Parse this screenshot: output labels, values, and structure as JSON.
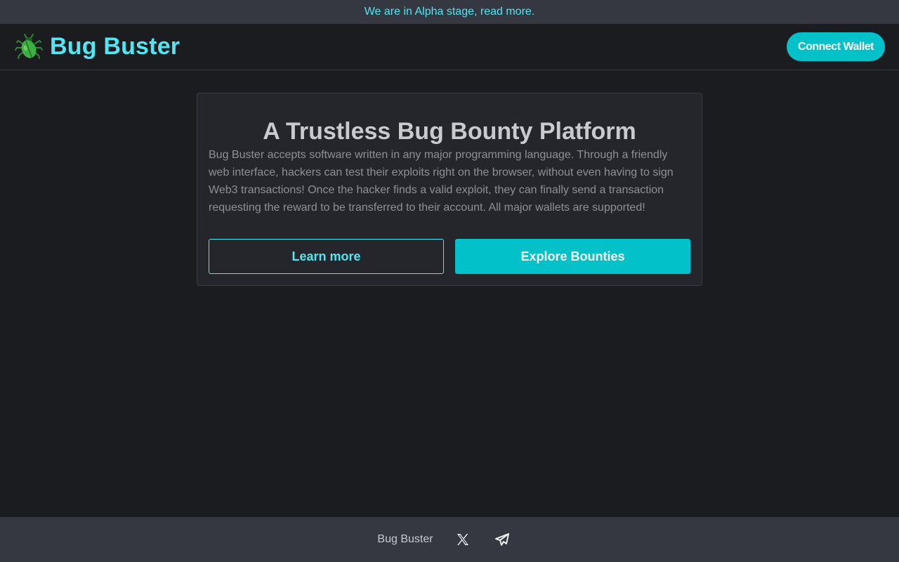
{
  "banner": {
    "text": "We are in Alpha stage, read more."
  },
  "header": {
    "app_name": "Bug Buster",
    "logo_icon": "beetle-icon",
    "connect_wallet_label": "Connect Wallet"
  },
  "hero": {
    "title": "A Trustless Bug Bounty Platform",
    "description": "Bug Buster accepts software written in any major programming language. Through a friendly web interface, hackers can test their exploits right on the browser, without even having to sign Web3 transactions! Once the hacker finds a valid exploit, they can finally send a transaction requesting the reward to be transferred to their account. All major wallets are supported!",
    "learn_more_label": "Learn more",
    "explore_label": "Explore Bounties"
  },
  "footer": {
    "brand": "Bug Buster",
    "social": [
      {
        "icon": "x-twitter-icon"
      },
      {
        "icon": "telegram-icon"
      }
    ]
  },
  "colors": {
    "accent": "#52e6f2",
    "button_fill": "#02c1c8",
    "background": "#1b1c20",
    "banner_bg": "#353841",
    "card_bg": "#25262b"
  }
}
